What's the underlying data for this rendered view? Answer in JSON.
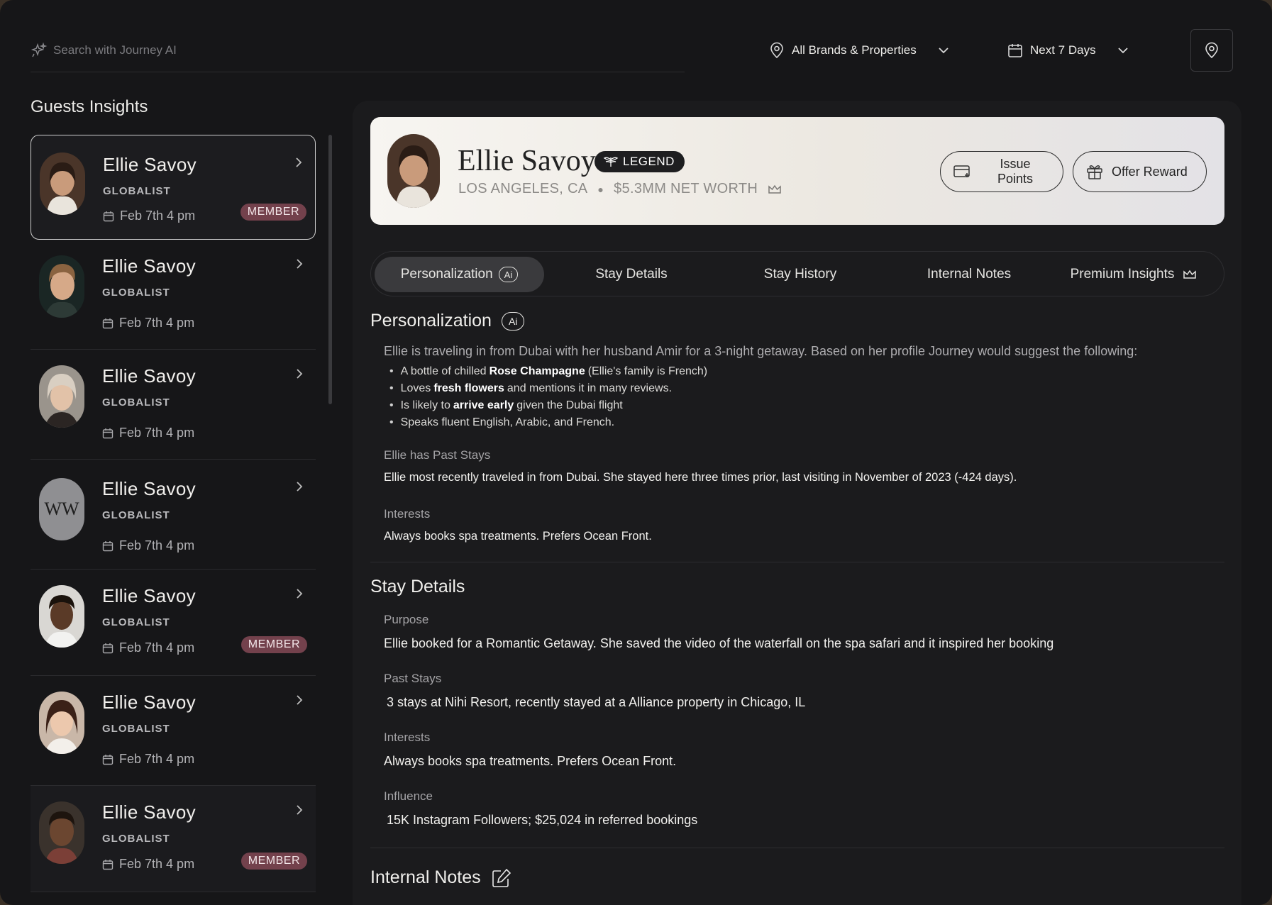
{
  "search": {
    "placeholder": "Search with Journey AI"
  },
  "filters": {
    "brands": "All Brands & Properties",
    "dates": "Next 7 Days"
  },
  "sidebar": {
    "title": "Guests Insights",
    "guests": [
      {
        "name": "Ellie Savoy",
        "tier": "GLOBALIST",
        "date": "Feb 7th 4 pm",
        "badge": "MEMBER"
      },
      {
        "name": "Ellie Savoy",
        "tier": "GLOBALIST",
        "date": "Feb 7th 4 pm",
        "badge": ""
      },
      {
        "name": "Ellie Savoy",
        "tier": "GLOBALIST",
        "date": "Feb 7th 4 pm",
        "badge": ""
      },
      {
        "name": "Ellie Savoy",
        "tier": "GLOBALIST",
        "date": "Feb 7th 4 pm",
        "badge": "",
        "initials": "WW"
      },
      {
        "name": "Ellie Savoy",
        "tier": "GLOBALIST",
        "date": "Feb 7th 4 pm",
        "badge": "MEMBER"
      },
      {
        "name": "Ellie Savoy",
        "tier": "GLOBALIST",
        "date": "Feb 7th 4 pm",
        "badge": ""
      },
      {
        "name": "Ellie Savoy",
        "tier": "GLOBALIST",
        "date": "Feb 7th 4 pm",
        "badge": "MEMBER"
      }
    ]
  },
  "profile": {
    "name": "Ellie Savoy",
    "status_badge": "LEGEND",
    "location": "LOS ANGELES, CA",
    "net_worth": "$5.3MM NET WORTH",
    "issue_points": "Issue Points",
    "offer_reward": "Offer Reward"
  },
  "tabs": {
    "personalization": "Personalization",
    "ai": "Ai",
    "stay_details": "Stay Details",
    "stay_history": "Stay History",
    "internal_notes": "Internal Notes",
    "premium_insights": "Premium Insights"
  },
  "personalization": {
    "title": "Personalization",
    "ai": "Ai",
    "intro": "Ellie is traveling in from Dubai with her husband Amir for a 3-night getaway. Based on her profile Journey would suggest the following:",
    "bullets": [
      {
        "pre": "A bottle of chilled",
        "bold": "Rose Champagne",
        "post": "(Ellie's family is French)"
      },
      {
        "pre": "Loves",
        "bold": "fresh flowers",
        "post": "and mentions it in many reviews."
      },
      {
        "pre": "Is likely to",
        "bold": "arrive early",
        "post": "given the Dubai flight"
      },
      {
        "pre": "Speaks fluent English, Arabic, and French.",
        "bold": "",
        "post": ""
      }
    ],
    "past_stays_label": "Ellie has Past Stays",
    "past_stays_text": "Ellie most recently traveled in from Dubai. She stayed here three times prior, last visiting in November of 2023 (-424 days).",
    "interests_label": "Interests",
    "interests_text": "Always books spa treatments. Prefers Ocean Front."
  },
  "stay_details": {
    "title": "Stay Details",
    "purpose_label": "Purpose",
    "purpose_text": "Ellie booked for a Romantic Getaway. She saved the video of the waterfall on the spa safari and it inspired her booking",
    "past_stays_label": "Past Stays",
    "past_stays_text": "3 stays at Nihi Resort, recently stayed at a Alliance property in Chicago, IL",
    "interests_label": "Interests",
    "interests_text": "Always books spa treatments. Prefers Ocean Front.",
    "influence_label": "Influence",
    "influence_text": "15K Instagram Followers; $25,024 in referred bookings"
  },
  "internal_notes": {
    "title": "Internal Notes"
  }
}
